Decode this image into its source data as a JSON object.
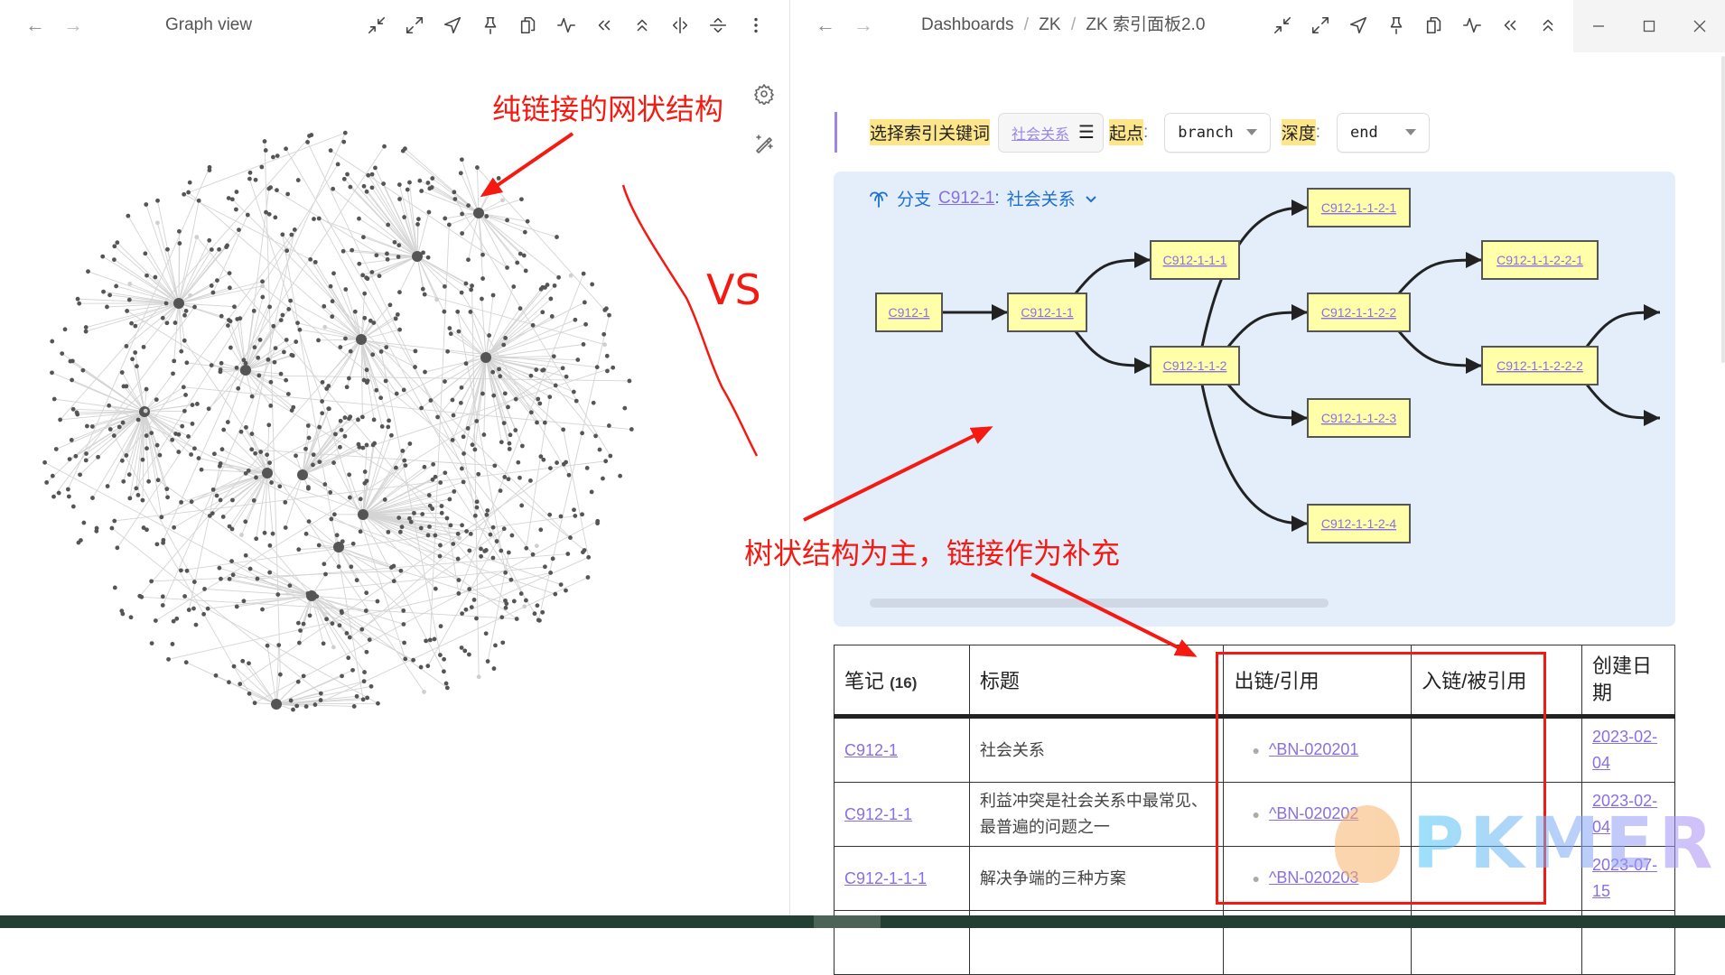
{
  "left_pane": {
    "title": "Graph view",
    "nav": {
      "back": "←",
      "forward": "→"
    },
    "tools": [
      "collapse-icon",
      "expand-icon",
      "navigate-icon",
      "pin-icon",
      "copy-icon",
      "activity-icon",
      "double-left-icon",
      "chevrons-up-icon",
      "split-vertical-icon",
      "split-horizontal-icon",
      "more-vertical-icon"
    ],
    "graph_controls": [
      "settings-icon",
      "magic-wand-icon"
    ]
  },
  "right_pane": {
    "breadcrumb": [
      "Dashboards",
      "ZK",
      "ZK 索引面板2.0"
    ],
    "breadcrumb_sep": "/",
    "nav": {
      "back": "←",
      "forward": "→"
    },
    "tools": [
      "collapse-icon",
      "expand-icon",
      "navigate-icon",
      "pin-icon",
      "copy-icon",
      "activity-icon",
      "double-left-icon",
      "chevrons-up-icon",
      "chevron-left-icon"
    ],
    "window_controls": [
      "minimize",
      "maximize",
      "close"
    ],
    "controls": {
      "keyword_label": "选择索引关键词",
      "keyword_value": "社会关系",
      "list_icon": "☰",
      "start_label": "起点",
      "start_value": "branch",
      "depth_label": "深度",
      "depth_value": "end",
      "colon": ":"
    },
    "branch": {
      "prefix": "分支",
      "id": "C912-1",
      "title": "社会关系",
      "sep": ":"
    },
    "tree": {
      "nodes": [
        {
          "id": "C912-1",
          "col": 0,
          "row": 2
        },
        {
          "id": "C912-1-1",
          "col": 1,
          "row": 2
        },
        {
          "id": "C912-1-1-1",
          "col": 2,
          "row": 1
        },
        {
          "id": "C912-1-1-2",
          "col": 2,
          "row": 3
        },
        {
          "id": "C912-1-1-2-1",
          "col": 3,
          "row": 0
        },
        {
          "id": "C912-1-1-2-2",
          "col": 3,
          "row": 2
        },
        {
          "id": "C912-1-1-2-3",
          "col": 3,
          "row": 4
        },
        {
          "id": "C912-1-1-2-4",
          "col": 3,
          "row": 6
        },
        {
          "id": "C912-1-1-2-2-1",
          "col": 4,
          "row": 1
        },
        {
          "id": "C912-1-1-2-2-2",
          "col": 4,
          "row": 3
        }
      ],
      "edges": [
        [
          "C912-1",
          "C912-1-1"
        ],
        [
          "C912-1-1",
          "C912-1-1-1"
        ],
        [
          "C912-1-1",
          "C912-1-1-2"
        ],
        [
          "C912-1-1-2",
          "C912-1-1-2-1"
        ],
        [
          "C912-1-1-2",
          "C912-1-1-2-2"
        ],
        [
          "C912-1-1-2",
          "C912-1-1-2-3"
        ],
        [
          "C912-1-1-2",
          "C912-1-1-2-4"
        ],
        [
          "C912-1-1-2-2",
          "C912-1-1-2-2-1"
        ],
        [
          "C912-1-1-2-2",
          "C912-1-1-2-2-2"
        ],
        [
          "C912-1-1-2-2-2",
          "(offscreen-1)"
        ],
        [
          "C912-1-1-2-2-2",
          "(offscreen-2)"
        ]
      ]
    },
    "table": {
      "headers": [
        "笔记",
        "标题",
        "出链/引用",
        "入链/被引用",
        "创建日期"
      ],
      "note_count": "(16)",
      "rows": [
        {
          "note": "C912-1",
          "title": "社会关系",
          "out": "^BN-020201",
          "in": "",
          "date": "2023-02-04"
        },
        {
          "note": "C912-1-1",
          "title": "利益冲突是社会关系中最常见、最普遍的问题之一",
          "out": "^BN-020202",
          "in": "",
          "date": "2023-02-04"
        },
        {
          "note": "C912-1-1-1",
          "title": "解决争端的三种方案",
          "out": "^BN-020203",
          "in": "",
          "date": "2023-07-15"
        }
      ]
    }
  },
  "annotations": {
    "network": "纯链接的网状结构",
    "vs": "VS",
    "tree": "树状结构为主，链接作为补充"
  },
  "watermark": "PKMER",
  "colors": {
    "accent": "#9d86e6",
    "link": "#8a6fe0",
    "highlight": "#fde68a",
    "tree_bg": "#e4eefb",
    "node_fill": "#ffffaa",
    "annotation": "#f41a12",
    "statusbar": "#233f33"
  }
}
